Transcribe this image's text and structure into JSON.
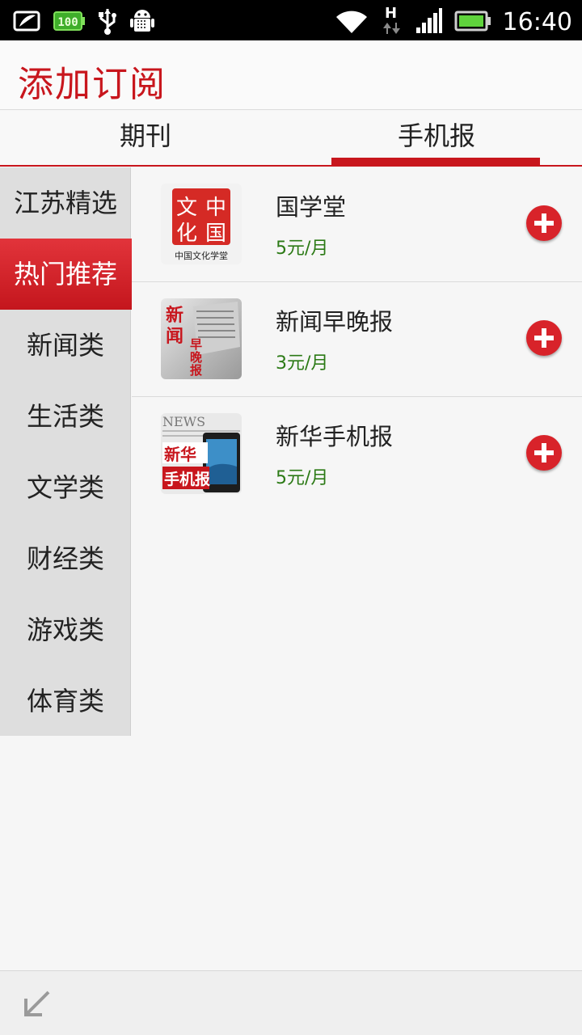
{
  "status_bar": {
    "time": "16:40",
    "icons": [
      "screenshot-icon",
      "battery-saver-icon",
      "usb-icon",
      "android-debug-icon",
      "wifi-icon",
      "hspa-data-icon",
      "signal-icon",
      "battery-icon"
    ],
    "network_label": "H"
  },
  "header": {
    "title": "添加订阅"
  },
  "tabs": [
    {
      "label": "期刊",
      "selected": false
    },
    {
      "label": "手机报",
      "selected": true
    }
  ],
  "sidebar": {
    "items": [
      {
        "label": "江苏精选",
        "selected": false
      },
      {
        "label": "热门推荐",
        "selected": true
      },
      {
        "label": "新闻类",
        "selected": false
      },
      {
        "label": "生活类",
        "selected": false
      },
      {
        "label": "文学类",
        "selected": false
      },
      {
        "label": "财经类",
        "selected": false
      },
      {
        "label": "游戏类",
        "selected": false
      },
      {
        "label": "体育类",
        "selected": false
      }
    ]
  },
  "list": {
    "items": [
      {
        "title": "国学堂",
        "price": "5元/月",
        "thumb_text": "中国文化学堂",
        "thumb_glyphs": "文中化国",
        "icon": "chinese-culture-seal-icon"
      },
      {
        "title": "新闻早晚报",
        "price": "3元/月",
        "thumb_glyphs": "新闻早晚报",
        "icon": "newspaper-icon"
      },
      {
        "title": "新华手机报",
        "price": "5元/月",
        "thumb_glyphs": "新华手机报",
        "thumb_banner": "NEWS",
        "icon": "mobile-newspaper-icon"
      }
    ]
  },
  "colors": {
    "accent": "#c8161d",
    "price": "#2c7a16",
    "add_button": "#d8232a"
  }
}
